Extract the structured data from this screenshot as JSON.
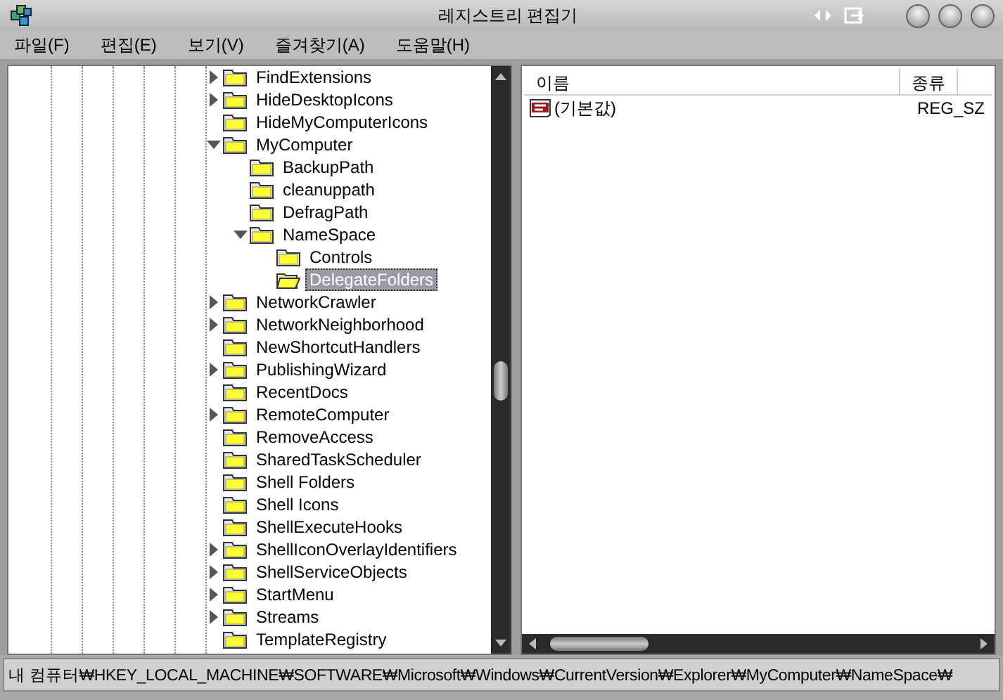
{
  "window": {
    "title": "레지스트리 편집기"
  },
  "menu": [
    "파일(F)",
    "편집(E)",
    "보기(V)",
    "즐겨찾기(A)",
    "도움말(H)"
  ],
  "tree": {
    "items": [
      {
        "label": "FindExtensions",
        "expandable": true,
        "expanded": false,
        "selected": false
      },
      {
        "label": "HideDesktopIcons",
        "expandable": true,
        "expanded": false,
        "selected": false
      },
      {
        "label": "HideMyComputerIcons",
        "expandable": false,
        "selected": false
      },
      {
        "label": "MyComputer",
        "expandable": true,
        "expanded": true,
        "selected": false,
        "children": [
          {
            "label": "BackupPath",
            "expandable": false,
            "selected": false
          },
          {
            "label": "cleanuppath",
            "expandable": false,
            "selected": false
          },
          {
            "label": "DefragPath",
            "expandable": false,
            "selected": false
          },
          {
            "label": "NameSpace",
            "expandable": true,
            "expanded": true,
            "selected": false,
            "children": [
              {
                "label": "Controls",
                "expandable": false,
                "selected": false
              },
              {
                "label": "DelegateFolders",
                "expandable": false,
                "selected": true
              }
            ]
          }
        ]
      },
      {
        "label": "NetworkCrawler",
        "expandable": true,
        "expanded": false,
        "selected": false
      },
      {
        "label": "NetworkNeighborhood",
        "expandable": true,
        "expanded": false,
        "selected": false
      },
      {
        "label": "NewShortcutHandlers",
        "expandable": false,
        "selected": false
      },
      {
        "label": "PublishingWizard",
        "expandable": true,
        "expanded": false,
        "selected": false
      },
      {
        "label": "RecentDocs",
        "expandable": false,
        "selected": false
      },
      {
        "label": "RemoteComputer",
        "expandable": true,
        "expanded": false,
        "selected": false
      },
      {
        "label": "RemoveAccess",
        "expandable": false,
        "selected": false
      },
      {
        "label": "SharedTaskScheduler",
        "expandable": false,
        "selected": false
      },
      {
        "label": "Shell Folders",
        "expandable": false,
        "selected": false
      },
      {
        "label": "Shell Icons",
        "expandable": false,
        "selected": false
      },
      {
        "label": "ShellExecuteHooks",
        "expandable": false,
        "selected": false
      },
      {
        "label": "ShellIconOverlayIdentifiers",
        "expandable": true,
        "expanded": false,
        "selected": false
      },
      {
        "label": "ShellServiceObjects",
        "expandable": true,
        "expanded": false,
        "selected": false
      },
      {
        "label": "StartMenu",
        "expandable": true,
        "expanded": false,
        "selected": false
      },
      {
        "label": "Streams",
        "expandable": true,
        "expanded": false,
        "selected": false
      },
      {
        "label": "TemplateRegistry",
        "expandable": false,
        "selected": false
      }
    ]
  },
  "values": {
    "columns": [
      "이름",
      "종류"
    ],
    "rows": [
      {
        "name": "(기본값)",
        "type": "REG_SZ"
      }
    ]
  },
  "status_bar": "내 컴퓨터₩HKEY_LOCAL_MACHINE₩SOFTWARE₩Microsoft₩Windows₩CurrentVersion₩Explorer₩MyComputer₩NameSpace₩"
}
